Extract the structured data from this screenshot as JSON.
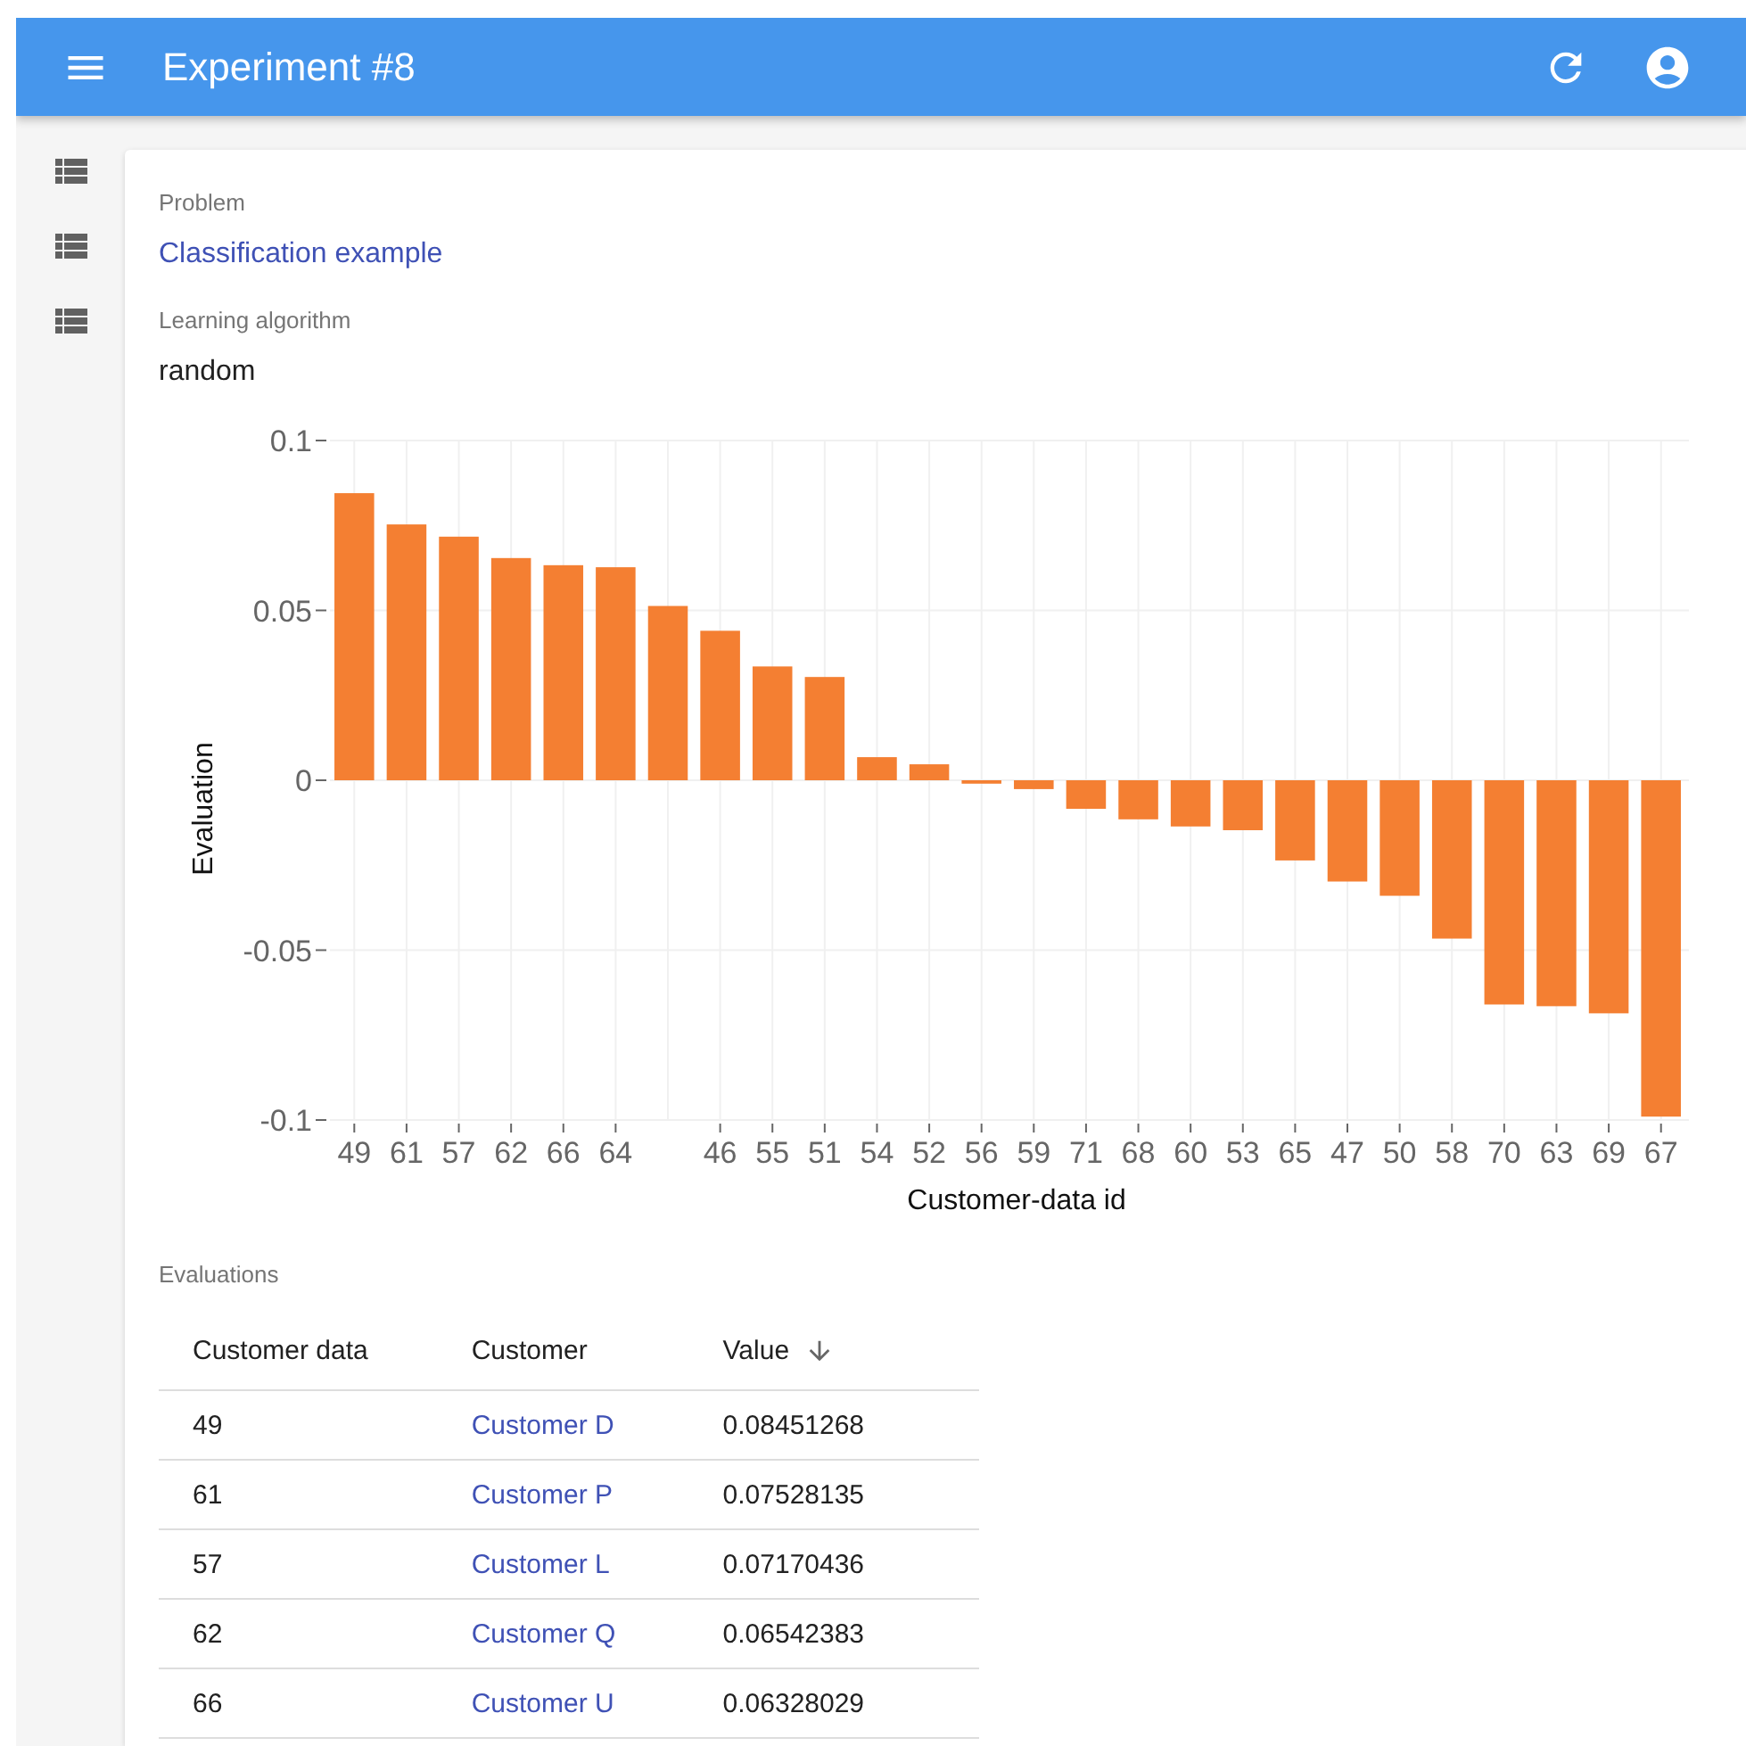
{
  "app_bar": {
    "title": "Experiment #8"
  },
  "sidebar": {
    "items": [
      {
        "kind": "list"
      },
      {
        "kind": "list"
      },
      {
        "kind": "list"
      }
    ]
  },
  "fields": [
    {
      "label": "Problem",
      "value": "Classification example",
      "kind": "link"
    },
    {
      "label": "Learning algorithm",
      "value": "random",
      "kind": "text"
    }
  ],
  "chart_data": {
    "type": "bar",
    "xlabel": "Customer-data id",
    "ylabel": "Evaluation",
    "categories": [
      "49",
      "61",
      "57",
      "62",
      "66",
      "64",
      null,
      "46",
      "55",
      "51",
      "54",
      "52",
      "56",
      "59",
      "71",
      "68",
      "60",
      "53",
      "65",
      "47",
      "50",
      "58",
      "70",
      "63",
      "69",
      "67"
    ],
    "grid": true,
    "series": [
      {
        "color": "#f47f32",
        "values": [
          0.0845,
          0.0753,
          0.0717,
          0.0654,
          0.0633,
          0.0627,
          0.0513,
          0.044,
          0.0335,
          0.0304,
          0.0068,
          0.0047,
          -0.001,
          -0.0026,
          -0.0084,
          -0.0115,
          -0.0136,
          -0.0147,
          -0.0236,
          -0.0298,
          -0.034,
          -0.0466,
          -0.066,
          -0.0665,
          -0.0686,
          -0.099
        ]
      }
    ],
    "ylim": [
      -0.1,
      0.1
    ],
    "yticks": [
      {
        "value": 0.1,
        "label": "0.1"
      },
      {
        "value": 0.05,
        "label": "0.05"
      },
      {
        "value": 0,
        "label": "0"
      },
      {
        "value": -0.05,
        "label": "-0.05"
      },
      {
        "value": -0.1,
        "label": "-0.1"
      }
    ]
  },
  "evaluations": {
    "title": "Evaluations",
    "columns": [
      {
        "label": "Customer data",
        "sorted": false
      },
      {
        "label": "Customer",
        "sorted": false
      },
      {
        "label": "Value",
        "sorted": true
      }
    ],
    "rows": [
      [
        "49",
        "Customer D",
        "0.08451268"
      ],
      [
        "61",
        "Customer P",
        "0.07528135"
      ],
      [
        "57",
        "Customer L",
        "0.07170436"
      ],
      [
        "62",
        "Customer Q",
        "0.06542383"
      ],
      [
        "66",
        "Customer U",
        "0.06328029"
      ]
    ]
  }
}
